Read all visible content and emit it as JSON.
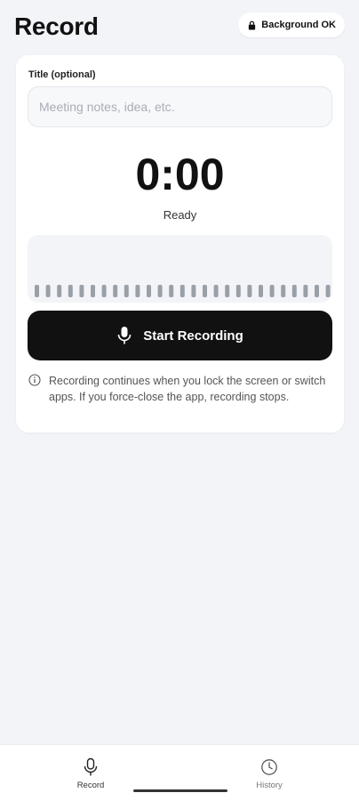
{
  "header": {
    "title": "Record",
    "background_badge": "Background OK"
  },
  "form": {
    "title_label": "Title (optional)",
    "title_placeholder": "Meeting notes, idea, etc.",
    "title_value": ""
  },
  "timer": {
    "display": "0:00",
    "status": "Ready"
  },
  "controls": {
    "start_label": "Start Recording"
  },
  "info": {
    "text": "Recording continues when you lock the screen or switch apps. If you force-close the app, recording stops."
  },
  "nav": {
    "items": [
      {
        "label": "Record",
        "icon": "mic-icon",
        "active": true
      },
      {
        "label": "History",
        "icon": "clock-icon",
        "active": false
      }
    ]
  },
  "colors": {
    "background": "#f2f4f8",
    "card": "#ffffff",
    "primary_button": "#111111",
    "waveform_bar": "#9aa0a8"
  }
}
